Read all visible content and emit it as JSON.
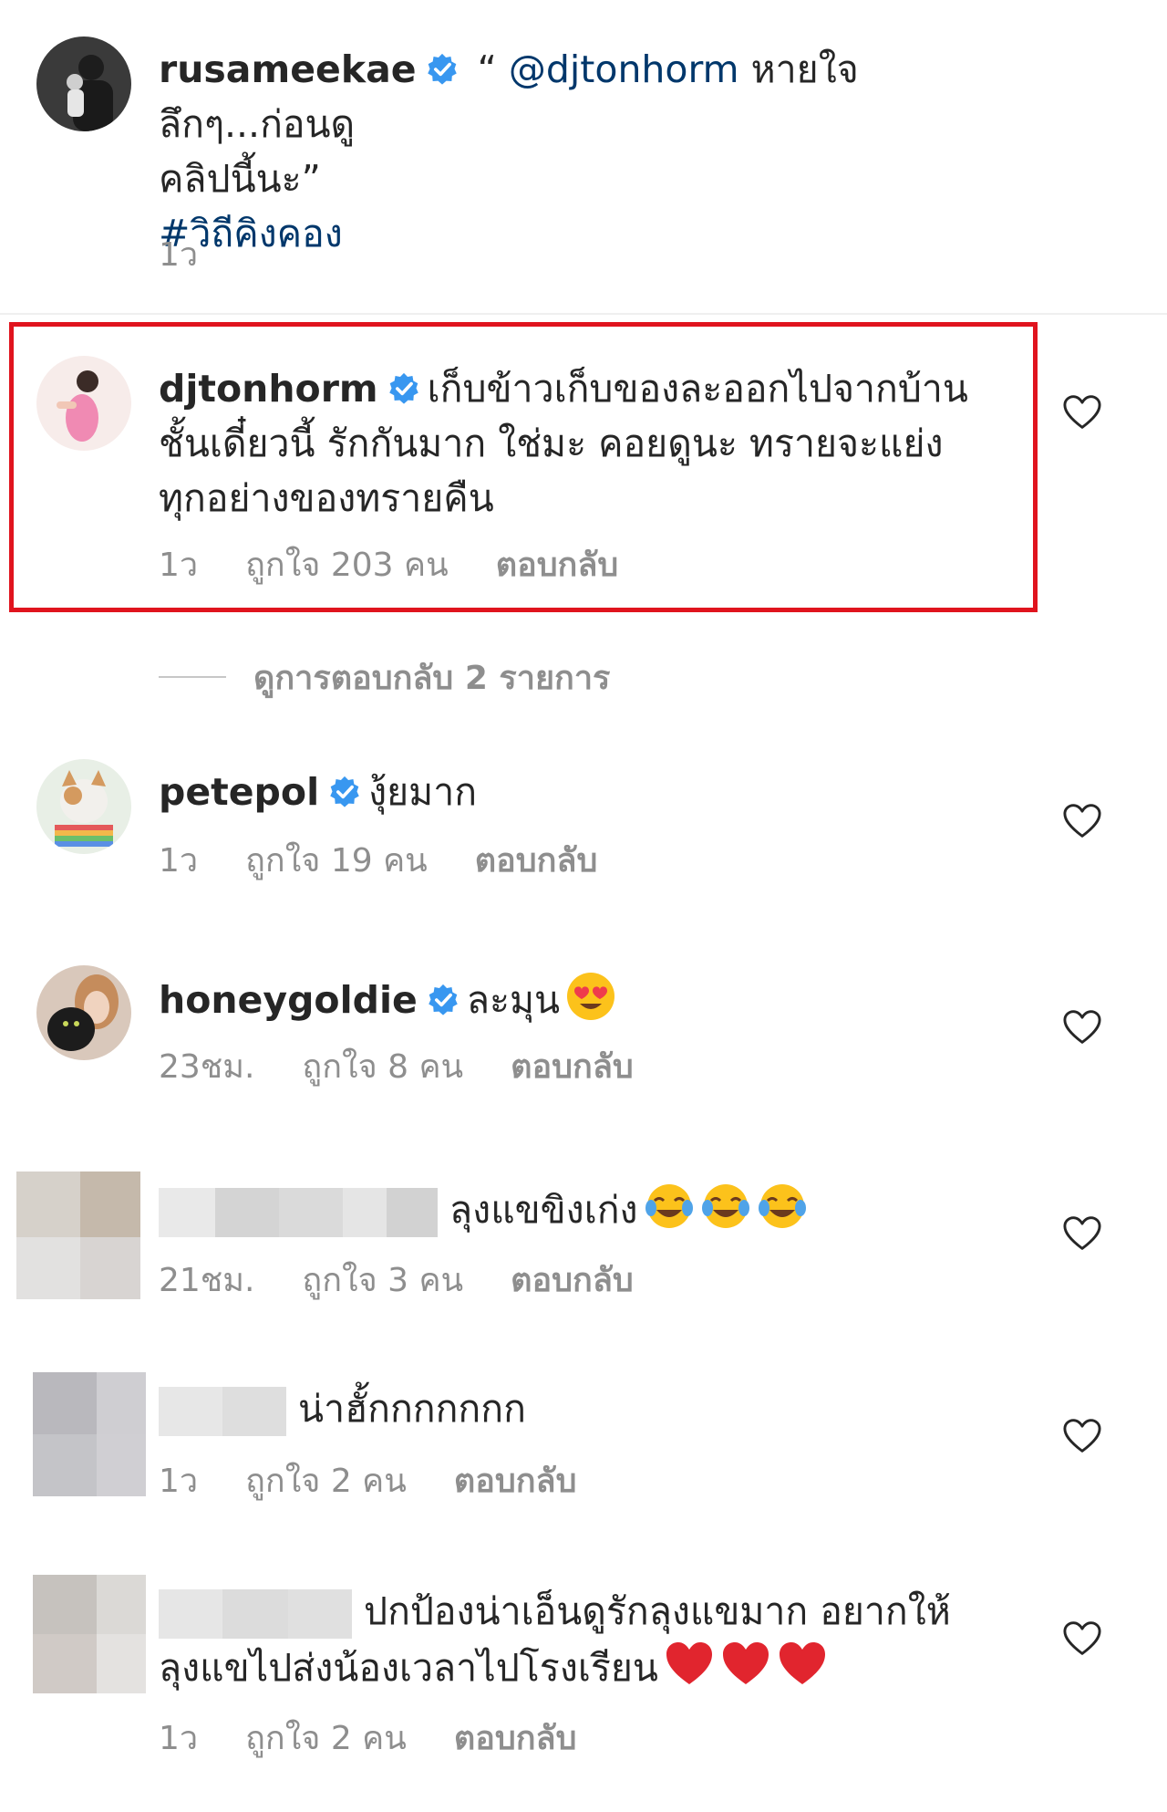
{
  "caption": {
    "username": "rusameekae",
    "text_prefix": " “ ",
    "mention": "@djtonhorm",
    "text_line1": " หายใจลึกๆ...ก่อนดู",
    "text_line2": "คลิปนี้นะ”",
    "hashtag": "#วิถีคิงคอง",
    "time": "1ว"
  },
  "comments": [
    {
      "username": "djtonhorm",
      "verified": true,
      "text_line1": "เก็บข้าวเก็บของละออกไปจากบ้าน",
      "text_line2": "ชั้นเดี๋ยวนี้ รักกันมาก ใช่มะ คอยดูนะ ทรายจะแย่ง",
      "text_line3": "ทุกอย่างของทรายคืน",
      "time": "1ว",
      "likes": "ถูกใจ 203 คน",
      "reply": "ตอบกลับ",
      "highlighted": true
    },
    {
      "username": "petepol",
      "verified": true,
      "text_line1": "งุ้ยมาก",
      "time": "1ว",
      "likes": "ถูกใจ 19 คน",
      "reply": "ตอบกลับ"
    },
    {
      "username": "honeygoldie",
      "verified": true,
      "text_line1": "ละมุน",
      "emoji": "heart-eyes",
      "time": "23ชม.",
      "likes": "ถูกใจ 8 คน",
      "reply": "ตอบกลับ"
    },
    {
      "username": "",
      "text_line1": "ลุงแขขิงเก่ง",
      "emoji": "tears-of-joy x3",
      "time": "21ชม.",
      "likes": "ถูกใจ 3 คน",
      "reply": "ตอบกลับ"
    },
    {
      "username": "",
      "text_line1": "น่าฮั้กกกกกกก",
      "time": "1ว",
      "likes": "ถูกใจ 2 คน",
      "reply": "ตอบกลับ"
    },
    {
      "username": "",
      "text_line1": "ปกป้องน่าเอ็นดูรักลุงแขมาก อยากให้",
      "text_line2": "ลุงแขไปส่งน้องเวลาไปโรงเรียน",
      "emoji": "red-heart x3",
      "time": "1ว",
      "likes": "ถูกใจ 2 คน",
      "reply": "ตอบกลับ"
    }
  ],
  "view_replies": "ดูการตอบกลับ 2 รายการ",
  "icons": {
    "verified": "verified-badge-icon",
    "like": "heart-outline-icon"
  },
  "colors": {
    "link": "#00376b",
    "verified": "#3897f0",
    "highlight_border": "#e0141e",
    "meta": "#8e8e8e"
  }
}
